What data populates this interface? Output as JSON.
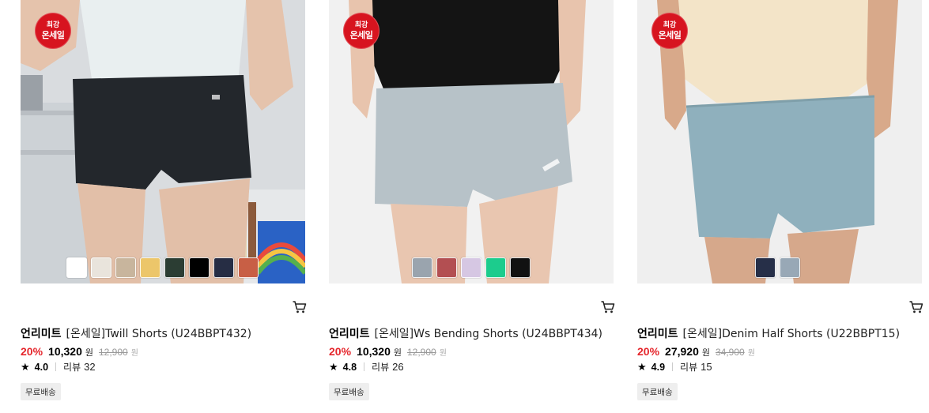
{
  "colors": {
    "sale_red": "#d7141f",
    "discount_red": "#e5262c",
    "tag_bg": "#eeeeee"
  },
  "products": [
    {
      "badge_line1": "최강",
      "badge_line2": "온세일",
      "swatches": [
        "#ffffff",
        "#e9e4dc",
        "#c8b59d",
        "#ecc66a",
        "#2b3d33",
        "#000000",
        "#262d44",
        "#c85f45"
      ],
      "brand": "언리미트",
      "name": "[온세일]Twill Shorts (U24BBPT432)",
      "discount": "20%",
      "price": "10,320",
      "currency": "원",
      "original_price": "12,900",
      "rating": "4.0",
      "review_label": "리뷰",
      "review_count": "32",
      "shipping_tag": "무료배송"
    },
    {
      "badge_line1": "최강",
      "badge_line2": "온세일",
      "swatches": [
        "#9aa4ae",
        "#b34f52",
        "#d6c7e3",
        "#1ccc8d",
        "#111111"
      ],
      "brand": "언리미트",
      "name": "[온세일]Ws Bending Shorts (U24BBPT434)",
      "discount": "20%",
      "price": "10,320",
      "currency": "원",
      "original_price": "12,900",
      "rating": "4.8",
      "review_label": "리뷰",
      "review_count": "26",
      "shipping_tag": "무료배송"
    },
    {
      "badge_line1": "최강",
      "badge_line2": "온세일",
      "swatches": [
        "#262f48",
        "#98a8b6"
      ],
      "brand": "언리미트",
      "name": "[온세일]Denim Half Shorts (U22BBPT15)",
      "discount": "20%",
      "price": "27,920",
      "currency": "원",
      "original_price": "34,900",
      "rating": "4.9",
      "review_label": "리뷰",
      "review_count": "15",
      "shipping_tag": "무료배송"
    }
  ]
}
